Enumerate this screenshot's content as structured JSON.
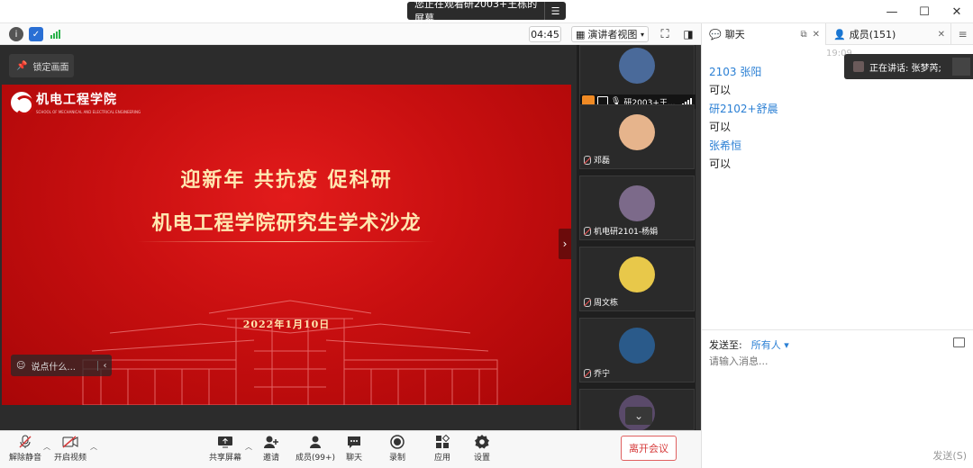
{
  "titlebar": {
    "sharing_text": "您正在观看研2003+王栋的屏幕",
    "window_controls": [
      "—",
      "☐",
      "✕"
    ]
  },
  "toolbar": {
    "timer": "04:45",
    "view_mode": "演讲者视图"
  },
  "stage": {
    "lock_label": "锁定画面",
    "chat_placeholder": "说点什么..."
  },
  "slide": {
    "college_name": "机电工程学院",
    "college_english": "SCHOOL OF MECHANICAL AND ELECTRICAL ENGINEERING",
    "headline": "迎新年  共抗疫  促科研",
    "subtitle": "机电工程学院研究生学术沙龙",
    "date": "2022年1月10日"
  },
  "participants": [
    {
      "name": "研2003+王...",
      "avatar_color": "#4a6a9a"
    },
    {
      "name": "邓磊",
      "avatar_color": "#e6b48c"
    },
    {
      "name": "机电研2101-杨娟",
      "avatar_color": "#7c6a8a"
    },
    {
      "name": "周文栋",
      "avatar_color": "#e8c84a"
    },
    {
      "name": "乔宁",
      "avatar_color": "#2a5a8a"
    }
  ],
  "controls": {
    "unmute": "解除静音",
    "start_video": "开启视频",
    "share_screen": "共享屏幕",
    "invite": "邀请",
    "members": "成员(99+)",
    "chat": "聊天",
    "record": "录制",
    "apps": "应用",
    "settings": "设置",
    "leave": "离开会议"
  },
  "panel": {
    "chat_tab": "聊天",
    "members_tab": "成员(151)",
    "timestamp": "19:09",
    "speaking": "正在讲话: 张梦芮;",
    "messages": [
      {
        "sender": "2103 张阳",
        "text": "可以"
      },
      {
        "sender": "研2102+舒晨",
        "text": "可以"
      },
      {
        "sender": "张希恒",
        "text": "可以"
      }
    ],
    "send_to_label": "发送至:",
    "send_to_value": "所有人",
    "input_placeholder": "请输入消息...",
    "send_button": "发送(S)"
  },
  "colors": {
    "accent_blue": "#2a7fd4",
    "leave_red": "#d63a3a",
    "slide_red": "#c80f10",
    "slide_gold": "#ffe7b0"
  }
}
